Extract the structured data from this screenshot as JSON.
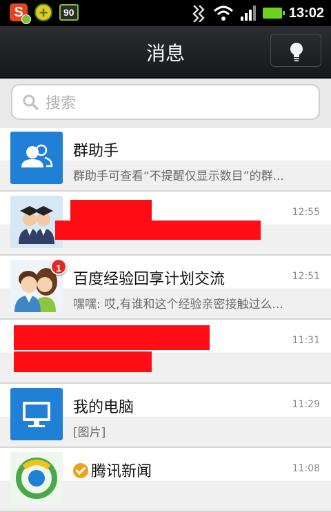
{
  "status_bar": {
    "time": "13:02",
    "battery_app_label": "90",
    "icons": [
      "sogou-s-icon",
      "plus-app-icon",
      "battery-90-app-icon",
      "vibrate-icon",
      "wifi-icon",
      "signal-icon",
      "battery-icon"
    ]
  },
  "header": {
    "title": "消息",
    "action_icon": "lightbulb-icon"
  },
  "search": {
    "placeholder": "搜索",
    "icon": "search-icon"
  },
  "conversations": [
    {
      "name": "群助手",
      "time": "",
      "preview": "群助手可查看“不提醒仅显示数目”的群...",
      "avatar": "group-assistant-icon"
    },
    {
      "name": "",
      "time": "12:55",
      "preview": "",
      "avatar": "graduates-avatar",
      "redacted": true
    },
    {
      "name": "百度经验回享计划交流",
      "time": "12:51",
      "preview": "嘿嘿: 哎,有谁和这个经验亲密接触过么...",
      "avatar": "couple-avatar",
      "unread": "1"
    },
    {
      "name": "",
      "time": "11:31",
      "preview": "",
      "avatar": "redacted-avatar",
      "redacted": true
    },
    {
      "name": "我的电脑",
      "time": "11:29",
      "preview": "[图片]",
      "avatar": "computer-icon"
    },
    {
      "name": "腾讯新闻",
      "time": "11:08",
      "preview": "",
      "avatar": "tencent-news-icon",
      "verified": true
    }
  ],
  "colors": {
    "accent_blue": "#1f80d6",
    "unread_badge": "#e02a2a",
    "redaction": "#ff0d14",
    "header_bg": "#1e2023"
  }
}
